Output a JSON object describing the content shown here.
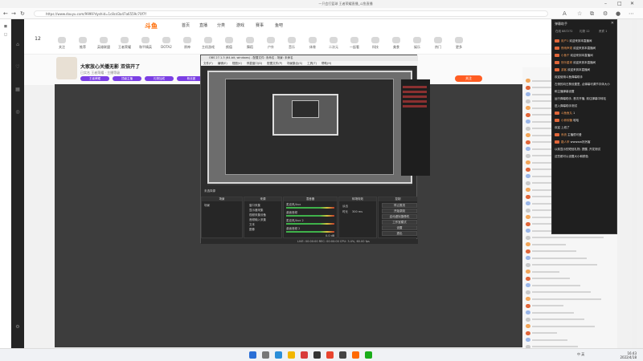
{
  "browser": {
    "window_title": "一只会打篮球 王者荣耀直播_斗鱼直播",
    "url": "https://www.douyu.com/9999?dyshid=1c8cd3a47a6559c70f7f"
  },
  "site": {
    "logo": "斗鱼",
    "nav": [
      "首页",
      "直播",
      "分类",
      "游戏",
      "赛事",
      "鱼吧"
    ],
    "category_count": "12",
    "categories": [
      "关注",
      "推荐",
      "英雄联盟",
      "王者荣耀",
      "和平精英",
      "DOTA2",
      "原神",
      "主机游戏",
      "颜值",
      "舞蹈",
      "户外",
      "音乐",
      "体育",
      "二次元",
      "一起看",
      "科技",
      "美食",
      "娱乐",
      "热门",
      "更多"
    ],
    "room": {
      "title": "大家放心关播无影 双倍开了",
      "meta": "已实名 王者荣耀 · 主播等级",
      "tags": [
        "王者荣耀",
        "顶级主播",
        "礼物加成",
        "粉丝团"
      ],
      "follow_label": "关注"
    }
  },
  "obs": {
    "title": "OBS 27.1.3 (64-bit, windows) - 配置文件: 未命名 - 场景: 未命名",
    "menu": [
      "文件(F)",
      "编辑(E)",
      "视图(V)",
      "停靠窗口(D)",
      "配置文件(P)",
      "场景集合(S)",
      "工具(T)",
      "帮助(H)"
    ],
    "status_line": "未选择源",
    "docks": {
      "scenes": {
        "title": "场景",
        "item": "场景"
      },
      "sources": {
        "title": "来源",
        "items": [
          "窗口采集",
          "显示器采集",
          "视频采集设备",
          "音频输入采集",
          "文本",
          "图像"
        ]
      },
      "mixer": {
        "title": "混音器",
        "channels": [
          "麦克风/Aux",
          "桌面音频",
          "麦克风/Aux 2",
          "桌面音频 2"
        ],
        "db": "0.0 dB"
      },
      "transitions": {
        "title": "转场特效",
        "type": "淡出",
        "duration_label": "时长",
        "duration": "300 ms"
      },
      "controls": {
        "title": "控制",
        "buttons": [
          "停止推流",
          "开始录制",
          "启动虚拟摄像机",
          "工作室模式",
          "设置",
          "退出"
        ]
      }
    },
    "statusbar": "LIVE: 00:00:00   REC: 00:00:00   CPU: 3.4%, 60.00 fps"
  },
  "chat": {
    "popup_title": "弹幕助手",
    "stats": [
      "在线 887272",
      "礼物 12",
      "贵宾 1"
    ],
    "lines": [
      {
        "name": "用户1",
        "text": "欢迎来到本直播间"
      },
      {
        "name": "夜雨声烦",
        "text": "欢迎来到本直播间"
      },
      {
        "name": "小鱼干",
        "text": "欢迎来到本直播间"
      },
      {
        "name": "快乐星球",
        "text": "欢迎来到本直播间"
      },
      {
        "name": "游客",
        "text": "欢迎来到本直播间"
      },
      {
        "name": "",
        "text": "欢迎使用斗鱼弹幕助手"
      },
      {
        "name": "",
        "text": "左侧的向日葵设置里, 点弹幕可调节字体大小"
      },
      {
        "name": "",
        "text": "和主播弹幕设置"
      },
      {
        "name": "",
        "text": "运行弹幕助手, 首次开播, 前往弹幕中转站"
      },
      {
        "name": "",
        "text": "进入弹幕助手测试"
      },
      {
        "name": "斗鱼鱼丸",
        "text": "1"
      },
      {
        "name": "小熊软糖",
        "text": "哈哈"
      },
      {
        "name": "",
        "text": "欢迎 上线了"
      },
      {
        "name": "系统",
        "text": "主播很可爱"
      },
      {
        "name": "路人甲",
        "text": "wwwww好厉害"
      },
      {
        "name": "",
        "text": "以前显示的短信礼物, 提醒, 开发测试"
      },
      {
        "name": "",
        "text": "这些都可以设置大小和颜色"
      }
    ]
  },
  "taskbar": {
    "time": "16:43",
    "date": "2022/4/18",
    "tray": "中 英"
  },
  "colors": {
    "accent": "#ff5d23",
    "obs_bg": "#2d2d2d",
    "popup_bg": "#1f1f1f"
  }
}
